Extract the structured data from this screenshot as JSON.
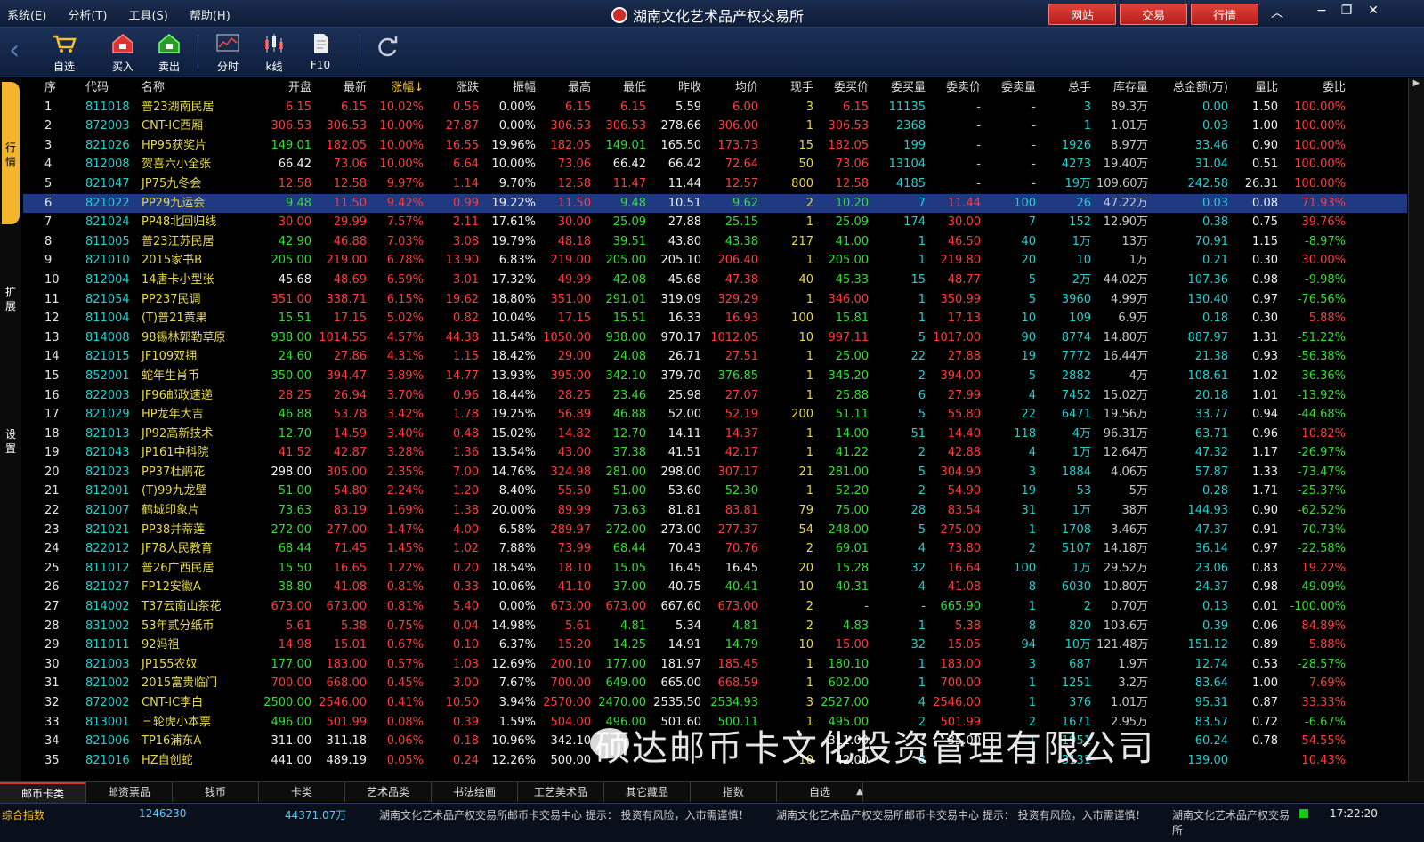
{
  "menu": [
    "系统(E)",
    "分析(T)",
    "工具(S)",
    "帮助(H)"
  ],
  "app_title": "湖南文化艺术品产权交易所",
  "top_buttons": [
    "网站",
    "交易",
    "行情"
  ],
  "toolbar": [
    "自选",
    "买入",
    "卖出",
    "分时",
    "k线",
    "F10"
  ],
  "side_tabs": [
    "行情",
    "扩展",
    "设置"
  ],
  "headers": [
    "序",
    "代码",
    "名称",
    "开盘",
    "最新",
    "涨幅↓",
    "涨跌",
    "振幅",
    "最高",
    "最低",
    "昨收",
    "均价",
    "现手",
    "委买价",
    "委买量",
    "委卖价",
    "委卖量",
    "总手",
    "库存量",
    "总金额(万)",
    "量比",
    "委比"
  ],
  "rows": [
    [
      "1",
      "811018",
      "普23湖南民居",
      "6.15",
      "6.15",
      "10.02%",
      "0.56",
      "0.00%",
      "6.15",
      "6.15",
      "5.59",
      "6.00",
      "3",
      "6.15",
      "11135",
      "-",
      "-",
      "3",
      "89.3万",
      "0.00",
      "1.50",
      "100.00%"
    ],
    [
      "2",
      "872003",
      "CNT-IC西厢",
      "306.53",
      "306.53",
      "10.00%",
      "27.87",
      "0.00%",
      "306.53",
      "306.53",
      "278.66",
      "306.00",
      "1",
      "306.53",
      "2368",
      "-",
      "-",
      "1",
      "1.01万",
      "0.03",
      "1.00",
      "100.00%"
    ],
    [
      "3",
      "821026",
      "HP95获奖片",
      "149.01",
      "182.05",
      "10.00%",
      "16.55",
      "19.96%",
      "182.05",
      "149.01",
      "165.50",
      "173.73",
      "15",
      "182.05",
      "199",
      "-",
      "-",
      "1926",
      "8.97万",
      "33.46",
      "0.90",
      "100.00%"
    ],
    [
      "4",
      "812008",
      "贺喜六小全张",
      "66.42",
      "73.06",
      "10.00%",
      "6.64",
      "10.00%",
      "73.06",
      "66.42",
      "66.42",
      "72.64",
      "50",
      "73.06",
      "13104",
      "-",
      "-",
      "4273",
      "19.40万",
      "31.04",
      "0.51",
      "100.00%"
    ],
    [
      "5",
      "821047",
      "JP75九冬会",
      "12.58",
      "12.58",
      "9.97%",
      "1.14",
      "9.70%",
      "12.58",
      "11.47",
      "11.44",
      "12.57",
      "800",
      "12.58",
      "4185",
      "-",
      "-",
      "19万",
      "109.60万",
      "242.58",
      "26.31",
      "100.00%"
    ],
    [
      "6",
      "821022",
      "PP29九运会",
      "9.48",
      "11.50",
      "9.42%",
      "0.99",
      "19.22%",
      "11.50",
      "9.48",
      "10.51",
      "9.62",
      "2",
      "10.20",
      "7",
      "11.44",
      "100",
      "26",
      "47.22万",
      "0.03",
      "0.08",
      "71.93%"
    ],
    [
      "7",
      "821024",
      "PP48北回归线",
      "30.00",
      "29.99",
      "7.57%",
      "2.11",
      "17.61%",
      "30.00",
      "25.09",
      "27.88",
      "25.15",
      "1",
      "25.09",
      "174",
      "30.00",
      "7",
      "152",
      "12.90万",
      "0.38",
      "0.75",
      "39.76%"
    ],
    [
      "8",
      "811005",
      "普23江苏民居",
      "42.90",
      "46.88",
      "7.03%",
      "3.08",
      "19.79%",
      "48.18",
      "39.51",
      "43.80",
      "43.38",
      "217",
      "41.00",
      "1",
      "46.50",
      "40",
      "1万",
      "13万",
      "70.91",
      "1.15",
      "-8.97%"
    ],
    [
      "9",
      "821010",
      "2015家书B",
      "205.00",
      "219.00",
      "6.78%",
      "13.90",
      "6.83%",
      "219.00",
      "205.00",
      "205.10",
      "206.40",
      "1",
      "205.00",
      "1",
      "219.80",
      "20",
      "10",
      "1万",
      "0.21",
      "0.30",
      "30.00%"
    ],
    [
      "10",
      "812004",
      "14唐卡小型张",
      "45.68",
      "48.69",
      "6.59%",
      "3.01",
      "17.32%",
      "49.99",
      "42.08",
      "45.68",
      "47.38",
      "40",
      "45.33",
      "15",
      "48.77",
      "5",
      "2万",
      "44.02万",
      "107.36",
      "0.98",
      "-9.98%"
    ],
    [
      "11",
      "821054",
      "PP237民调",
      "351.00",
      "338.71",
      "6.15%",
      "19.62",
      "18.80%",
      "351.00",
      "291.01",
      "319.09",
      "329.29",
      "1",
      "346.00",
      "1",
      "350.99",
      "5",
      "3960",
      "4.99万",
      "130.40",
      "0.97",
      "-76.56%"
    ],
    [
      "12",
      "811004",
      "(T)普21黄果",
      "15.51",
      "17.15",
      "5.02%",
      "0.82",
      "10.04%",
      "17.15",
      "15.51",
      "16.33",
      "16.93",
      "100",
      "15.81",
      "1",
      "17.13",
      "10",
      "109",
      "6.9万",
      "0.18",
      "0.30",
      "5.88%"
    ],
    [
      "13",
      "814008",
      "98锡林郭勒草原",
      "938.00",
      "1014.55",
      "4.57%",
      "44.38",
      "11.54%",
      "1050.00",
      "938.00",
      "970.17",
      "1012.05",
      "10",
      "997.11",
      "5",
      "1017.00",
      "90",
      "8774",
      "14.80万",
      "887.97",
      "1.31",
      "-51.22%"
    ],
    [
      "14",
      "821015",
      "JF109双拥",
      "24.60",
      "27.86",
      "4.31%",
      "1.15",
      "18.42%",
      "29.00",
      "24.08",
      "26.71",
      "27.51",
      "1",
      "25.00",
      "22",
      "27.88",
      "19",
      "7772",
      "16.44万",
      "21.38",
      "0.93",
      "-56.38%"
    ],
    [
      "15",
      "852001",
      "蛇年生肖币",
      "350.00",
      "394.47",
      "3.89%",
      "14.77",
      "13.93%",
      "395.00",
      "342.10",
      "379.70",
      "376.85",
      "1",
      "345.20",
      "2",
      "394.00",
      "5",
      "2882",
      "4万",
      "108.61",
      "1.02",
      "-36.36%"
    ],
    [
      "16",
      "822003",
      "JF96邮政速递",
      "28.25",
      "26.94",
      "3.70%",
      "0.96",
      "18.44%",
      "28.25",
      "23.46",
      "25.98",
      "27.07",
      "1",
      "25.88",
      "6",
      "27.99",
      "4",
      "7452",
      "15.02万",
      "20.18",
      "1.01",
      "-13.92%"
    ],
    [
      "17",
      "821029",
      "HP龙年大吉",
      "46.88",
      "53.78",
      "3.42%",
      "1.78",
      "19.25%",
      "56.89",
      "46.88",
      "52.00",
      "52.19",
      "200",
      "51.11",
      "5",
      "55.80",
      "22",
      "6471",
      "19.56万",
      "33.77",
      "0.94",
      "-44.68%"
    ],
    [
      "18",
      "821013",
      "JP92高新技术",
      "12.70",
      "14.59",
      "3.40%",
      "0.48",
      "15.02%",
      "14.82",
      "12.70",
      "14.11",
      "14.37",
      "1",
      "14.00",
      "51",
      "14.40",
      "118",
      "4万",
      "96.31万",
      "63.71",
      "0.96",
      "10.82%"
    ],
    [
      "19",
      "821043",
      "JP161中科院",
      "41.52",
      "42.87",
      "3.28%",
      "1.36",
      "13.54%",
      "43.00",
      "37.38",
      "41.51",
      "42.17",
      "1",
      "41.22",
      "2",
      "42.88",
      "4",
      "1万",
      "12.64万",
      "47.32",
      "1.17",
      "-26.97%"
    ],
    [
      "20",
      "821023",
      "PP37杜鹃花",
      "298.00",
      "305.00",
      "2.35%",
      "7.00",
      "14.76%",
      "324.98",
      "281.00",
      "298.00",
      "307.17",
      "21",
      "281.00",
      "5",
      "304.90",
      "3",
      "1884",
      "4.06万",
      "57.87",
      "1.33",
      "-73.47%"
    ],
    [
      "21",
      "812001",
      "(T)99九龙壁",
      "51.00",
      "54.80",
      "2.24%",
      "1.20",
      "8.40%",
      "55.50",
      "51.00",
      "53.60",
      "52.30",
      "1",
      "52.20",
      "2",
      "54.90",
      "19",
      "53",
      "5万",
      "0.28",
      "1.71",
      "-25.37%"
    ],
    [
      "22",
      "821007",
      "鹤城印象片",
      "73.63",
      "83.19",
      "1.69%",
      "1.38",
      "20.00%",
      "89.99",
      "73.63",
      "81.81",
      "83.81",
      "79",
      "75.00",
      "28",
      "83.54",
      "31",
      "1万",
      "38万",
      "144.93",
      "0.90",
      "-62.52%"
    ],
    [
      "23",
      "821021",
      "PP38并蒂莲",
      "272.00",
      "277.00",
      "1.47%",
      "4.00",
      "6.58%",
      "289.97",
      "272.00",
      "273.00",
      "277.37",
      "54",
      "248.00",
      "5",
      "275.00",
      "1",
      "1708",
      "3.46万",
      "47.37",
      "0.91",
      "-70.73%"
    ],
    [
      "24",
      "822012",
      "JF78人民教育",
      "68.44",
      "71.45",
      "1.45%",
      "1.02",
      "7.88%",
      "73.99",
      "68.44",
      "70.43",
      "70.76",
      "2",
      "69.01",
      "4",
      "73.80",
      "2",
      "5107",
      "14.18万",
      "36.14",
      "0.97",
      "-22.58%"
    ],
    [
      "25",
      "811012",
      "普26广西民居",
      "15.50",
      "16.65",
      "1.22%",
      "0.20",
      "18.54%",
      "18.10",
      "15.05",
      "16.45",
      "16.45",
      "20",
      "15.28",
      "32",
      "16.64",
      "100",
      "1万",
      "29.52万",
      "23.06",
      "0.83",
      "19.22%"
    ],
    [
      "26",
      "821027",
      "FP12安徽A",
      "38.80",
      "41.08",
      "0.81%",
      "0.33",
      "10.06%",
      "41.10",
      "37.00",
      "40.75",
      "40.41",
      "10",
      "40.31",
      "4",
      "41.08",
      "8",
      "6030",
      "10.80万",
      "24.37",
      "0.98",
      "-49.09%"
    ],
    [
      "27",
      "814002",
      "T37云南山茶花",
      "673.00",
      "673.00",
      "0.81%",
      "5.40",
      "0.00%",
      "673.00",
      "673.00",
      "667.60",
      "673.00",
      "2",
      "-",
      "-",
      "665.90",
      "1",
      "2",
      "0.70万",
      "0.13",
      "0.01",
      "-100.00%"
    ],
    [
      "28",
      "831002",
      "53年贰分纸币",
      "5.61",
      "5.38",
      "0.75%",
      "0.04",
      "14.98%",
      "5.61",
      "4.81",
      "5.34",
      "4.81",
      "2",
      "4.83",
      "1",
      "5.38",
      "8",
      "820",
      "103.6万",
      "0.39",
      "0.06",
      "84.89%"
    ],
    [
      "29",
      "811011",
      "92妈祖",
      "14.98",
      "15.01",
      "0.67%",
      "0.10",
      "6.37%",
      "15.20",
      "14.25",
      "14.91",
      "14.79",
      "10",
      "15.00",
      "32",
      "15.05",
      "94",
      "10万",
      "121.48万",
      "151.12",
      "0.89",
      "5.88%"
    ],
    [
      "30",
      "821003",
      "JP155农奴",
      "177.00",
      "183.00",
      "0.57%",
      "1.03",
      "12.69%",
      "200.10",
      "177.00",
      "181.97",
      "185.45",
      "1",
      "180.10",
      "1",
      "183.00",
      "3",
      "687",
      "1.9万",
      "12.74",
      "0.53",
      "-28.57%"
    ],
    [
      "31",
      "821002",
      "2015富贵临门",
      "700.00",
      "668.00",
      "0.45%",
      "3.00",
      "7.67%",
      "700.00",
      "649.00",
      "665.00",
      "668.59",
      "1",
      "602.00",
      "1",
      "700.00",
      "1",
      "1251",
      "3.2万",
      "83.64",
      "1.00",
      "7.69%"
    ],
    [
      "32",
      "872002",
      "CNT-IC李白",
      "2500.00",
      "2546.00",
      "0.41%",
      "10.50",
      "3.94%",
      "2570.00",
      "2470.00",
      "2535.50",
      "2534.93",
      "3",
      "2527.00",
      "4",
      "2546.00",
      "1",
      "376",
      "1.01万",
      "95.31",
      "0.87",
      "33.33%"
    ],
    [
      "33",
      "813001",
      "三轮虎小本票",
      "496.00",
      "501.99",
      "0.08%",
      "0.39",
      "1.59%",
      "504.00",
      "496.00",
      "501.60",
      "500.11",
      "1",
      "495.00",
      "2",
      "501.99",
      "2",
      "1671",
      "2.95万",
      "83.57",
      "0.72",
      "-6.67%"
    ],
    [
      "34",
      "821006",
      "TP16浦东A",
      "311.00",
      "311.18",
      "0.06%",
      "0.18",
      "10.96%",
      "342.10",
      "",
      "",
      "",
      "",
      "311.00",
      "",
      "35.00",
      "1",
      "1951",
      "",
      "60.24",
      "0.78",
      "54.55%"
    ],
    [
      "35",
      "821016",
      "HZ自创蛇",
      "441.00",
      "489.19",
      "0.05%",
      "0.24",
      "12.26%",
      "500.00",
      "",
      "",
      "",
      "10",
      "42.00",
      "8",
      "",
      "1",
      "3131",
      "",
      "139.00",
      "",
      "10.43%"
    ]
  ],
  "bottom_tabs": [
    "邮币卡类",
    "邮资票品",
    "钱币",
    "卡类",
    "艺术品类",
    "书法绘画",
    "工艺美术品",
    "其它藏品",
    "指数",
    "自选"
  ],
  "status": {
    "label": "综合指数",
    "volume": "1246230",
    "amount": "44371.07万",
    "ticker": "湖南文化艺术品产权交易所邮币卡交易中心  提示：  投资有风险，入市需谨慎！",
    "ticker2": "湖南文化艺术品产权交易所邮币卡交易中心  提示：  投资有风险，入市需谨慎！",
    "ticker3": "湖南文化艺术品产权交易所",
    "time": "17:22:20"
  },
  "watermark": "硕达邮币卡文化投资管理有限公司",
  "colors": {
    "up": "#ff3b3b",
    "down": "#33dd33",
    "code": "#20d0d0",
    "name": "#e6d84a",
    "selected": "#1f3a82"
  }
}
